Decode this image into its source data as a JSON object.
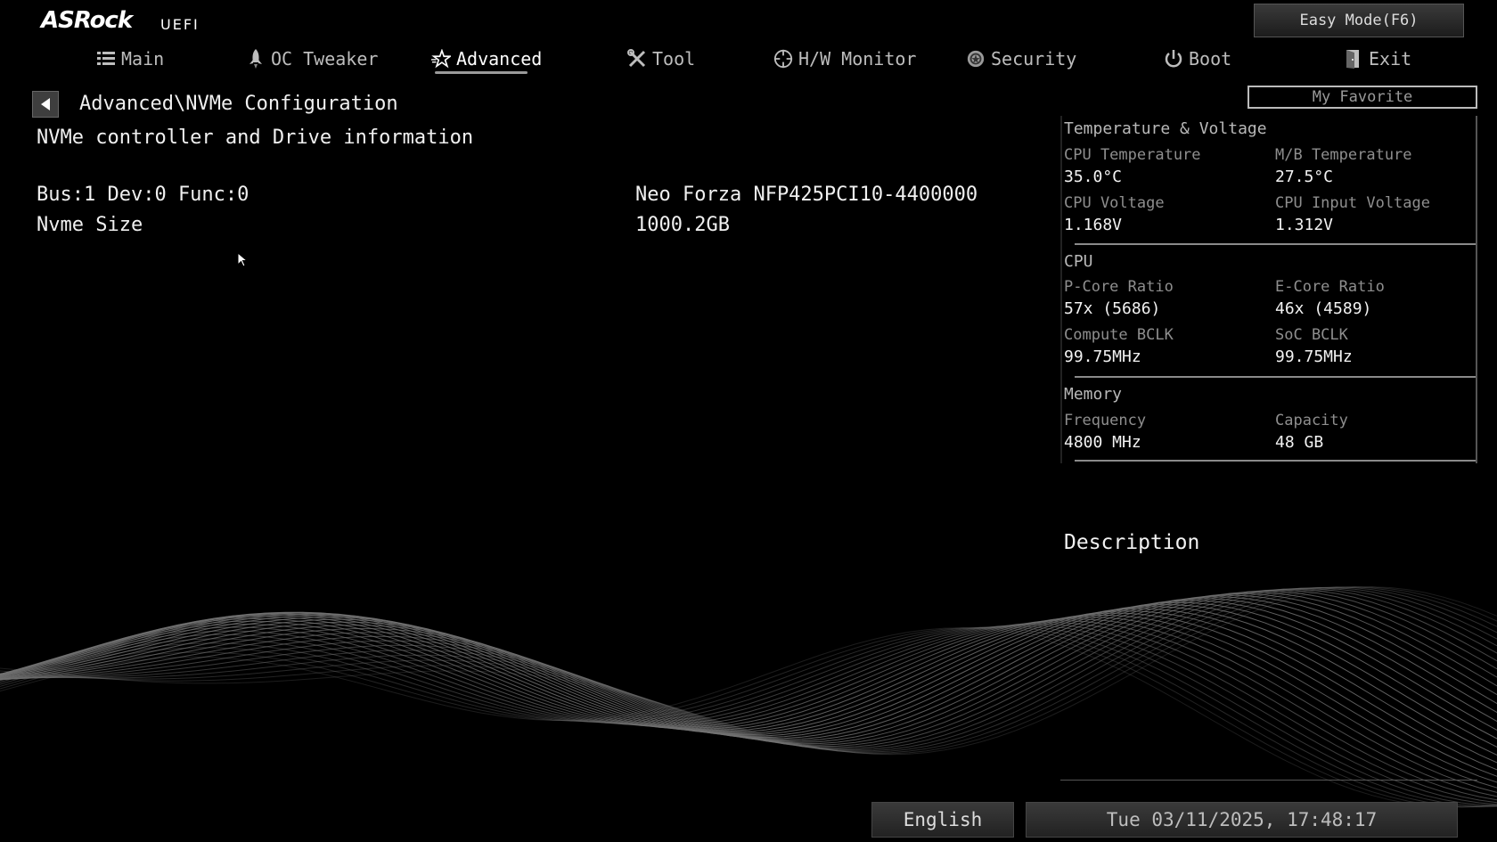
{
  "brand": {
    "logo": "ASRock",
    "sub": "UEFI"
  },
  "easy_mode": "Easy Mode(F6)",
  "nav": [
    {
      "label": "Main",
      "icon": "list-icon"
    },
    {
      "label": "OC Tweaker",
      "icon": "rocket-icon"
    },
    {
      "label": "Advanced",
      "icon": "star-icon",
      "active": true
    },
    {
      "label": "Tool",
      "icon": "tools-icon"
    },
    {
      "label": "H/W Monitor",
      "icon": "crosshair-icon"
    },
    {
      "label": "Security",
      "icon": "shield-icon"
    },
    {
      "label": "Boot",
      "icon": "power-icon"
    },
    {
      "label": "Exit",
      "icon": "exit-door-icon"
    }
  ],
  "my_favorite": "My Favorite",
  "breadcrumb": "Advanced\\NVMe Configuration",
  "subtitle": "NVMe controller and Drive information",
  "rows": [
    {
      "label": "Bus:1 Dev:0 Func:0",
      "value": "Neo Forza NFP425PCI10-4400000"
    },
    {
      "label": "Nvme Size",
      "value": "1000.2GB"
    }
  ],
  "monitor": {
    "temp_voltage": {
      "title": "Temperature & Voltage",
      "items": [
        {
          "k": "CPU Temperature",
          "v": "35.0°C"
        },
        {
          "k": "M/B Temperature",
          "v": "27.5°C"
        },
        {
          "k": "CPU Voltage",
          "v": "1.168V"
        },
        {
          "k": "CPU Input Voltage",
          "v": "1.312V"
        }
      ]
    },
    "cpu": {
      "title": "CPU",
      "items": [
        {
          "k": "P-Core Ratio",
          "v": "57x (5686)"
        },
        {
          "k": "E-Core Ratio",
          "v": "46x (4589)"
        },
        {
          "k": "Compute BCLK",
          "v": "99.75MHz"
        },
        {
          "k": "SoC BCLK",
          "v": "99.75MHz"
        }
      ]
    },
    "memory": {
      "title": "Memory",
      "items": [
        {
          "k": "Frequency",
          "v": "4800 MHz"
        },
        {
          "k": "Capacity",
          "v": "48 GB"
        }
      ]
    }
  },
  "description_title": "Description",
  "language": "English",
  "datetime": "Tue 03/11/2025, 17:48:17"
}
